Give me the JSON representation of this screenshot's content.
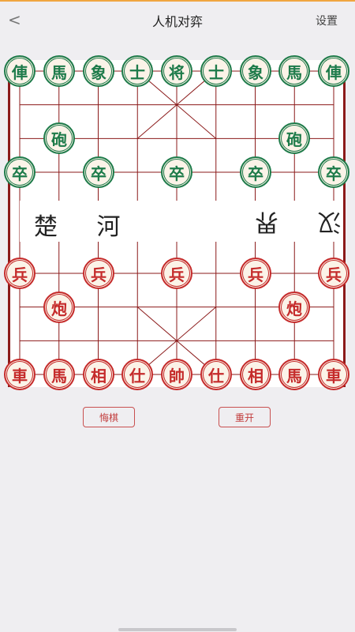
{
  "header": {
    "back_icon": "chevron-left-icon",
    "back_glyph": "<",
    "title": "人机对弈",
    "settings_label": "设置"
  },
  "board": {
    "river_left": "楚 河",
    "river_right": "汉 界"
  },
  "pieces": [
    {
      "side": "black",
      "text": "俥",
      "file": 0,
      "rank": 0
    },
    {
      "side": "black",
      "text": "馬",
      "file": 1,
      "rank": 0
    },
    {
      "side": "black",
      "text": "象",
      "file": 2,
      "rank": 0
    },
    {
      "side": "black",
      "text": "士",
      "file": 3,
      "rank": 0
    },
    {
      "side": "black",
      "text": "将",
      "file": 4,
      "rank": 0
    },
    {
      "side": "black",
      "text": "士",
      "file": 5,
      "rank": 0
    },
    {
      "side": "black",
      "text": "象",
      "file": 6,
      "rank": 0
    },
    {
      "side": "black",
      "text": "馬",
      "file": 7,
      "rank": 0
    },
    {
      "side": "black",
      "text": "俥",
      "file": 8,
      "rank": 0
    },
    {
      "side": "black",
      "text": "砲",
      "file": 1,
      "rank": 2
    },
    {
      "side": "black",
      "text": "砲",
      "file": 7,
      "rank": 2
    },
    {
      "side": "black",
      "text": "卒",
      "file": 0,
      "rank": 3
    },
    {
      "side": "black",
      "text": "卒",
      "file": 2,
      "rank": 3
    },
    {
      "side": "black",
      "text": "卒",
      "file": 4,
      "rank": 3
    },
    {
      "side": "black",
      "text": "卒",
      "file": 6,
      "rank": 3
    },
    {
      "side": "black",
      "text": "卒",
      "file": 8,
      "rank": 3
    },
    {
      "side": "red",
      "text": "兵",
      "file": 0,
      "rank": 6
    },
    {
      "side": "red",
      "text": "兵",
      "file": 2,
      "rank": 6
    },
    {
      "side": "red",
      "text": "兵",
      "file": 4,
      "rank": 6
    },
    {
      "side": "red",
      "text": "兵",
      "file": 6,
      "rank": 6
    },
    {
      "side": "red",
      "text": "兵",
      "file": 8,
      "rank": 6
    },
    {
      "side": "red",
      "text": "炮",
      "file": 1,
      "rank": 7
    },
    {
      "side": "red",
      "text": "炮",
      "file": 7,
      "rank": 7
    },
    {
      "side": "red",
      "text": "車",
      "file": 0,
      "rank": 9
    },
    {
      "side": "red",
      "text": "馬",
      "file": 1,
      "rank": 9
    },
    {
      "side": "red",
      "text": "相",
      "file": 2,
      "rank": 9
    },
    {
      "side": "red",
      "text": "仕",
      "file": 3,
      "rank": 9
    },
    {
      "side": "red",
      "text": "帥",
      "file": 4,
      "rank": 9
    },
    {
      "side": "red",
      "text": "仕",
      "file": 5,
      "rank": 9
    },
    {
      "side": "red",
      "text": "相",
      "file": 6,
      "rank": 9
    },
    {
      "side": "red",
      "text": "馬",
      "file": 7,
      "rank": 9
    },
    {
      "side": "red",
      "text": "車",
      "file": 8,
      "rank": 9
    }
  ],
  "colors": {
    "black_side": "#1e7b4a",
    "red_side": "#c52b2b",
    "grid": "#8b1a1a",
    "accent": "#f0a640"
  },
  "controls": {
    "undo_label": "悔棋",
    "restart_label": "重开"
  }
}
